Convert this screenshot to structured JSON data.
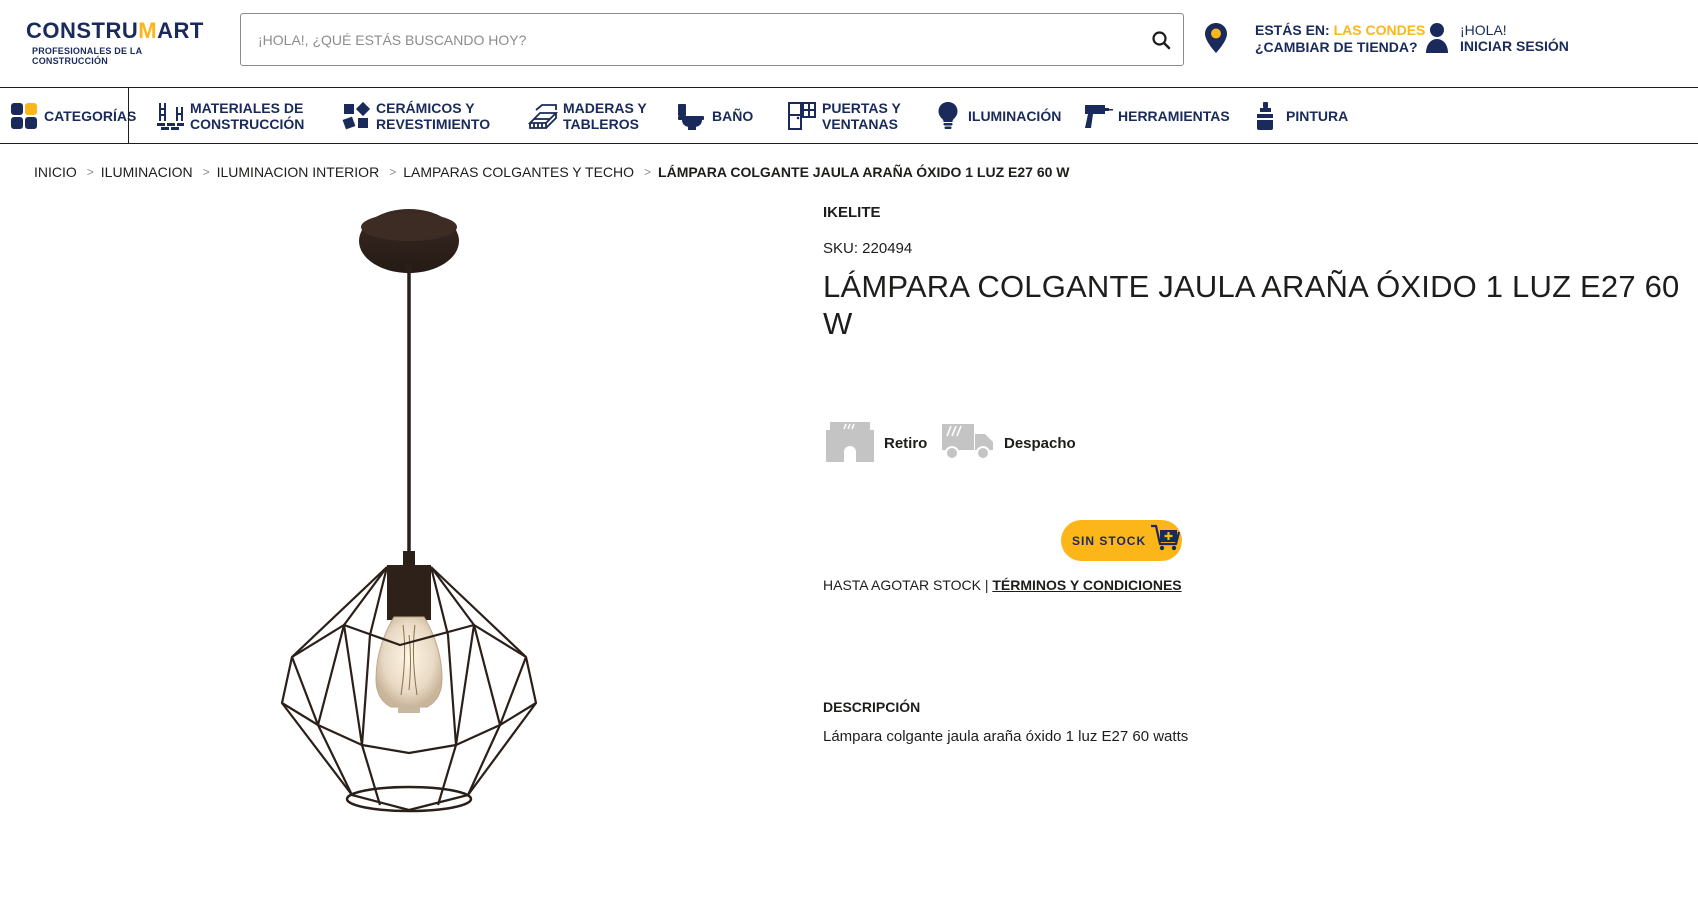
{
  "header": {
    "logo_main_a": "CONSTRU",
    "logo_main_m": "M",
    "logo_main_b": "ART",
    "logo_sub": "PROFESIONALES DE LA CONSTRUCCIÓN",
    "search_placeholder": "¡HOLA!, ¿QUÉ ESTÁS BUSCANDO HOY?",
    "location_prefix": "ESTÁS EN:",
    "location_store": "LAS CONDES",
    "location_change": "¿CAMBIAR DE TIENDA?",
    "user_greeting": "¡HOLA!",
    "user_login": "INICIAR SESIÓN"
  },
  "nav": {
    "items": [
      {
        "label": "CATEGORÍAS"
      },
      {
        "label_1": "MATERIALES DE",
        "label_2": "CONSTRUCCIÓN"
      },
      {
        "label_1": "CERÁMICOS Y",
        "label_2": "REVESTIMIENTO"
      },
      {
        "label_1": "MADERAS Y",
        "label_2": "TABLEROS"
      },
      {
        "label": "BAÑO"
      },
      {
        "label_1": "PUERTAS Y",
        "label_2": "VENTANAS"
      },
      {
        "label": "ILUMINACIÓN"
      },
      {
        "label": "HERRAMIENTAS"
      },
      {
        "label": "PINTURA"
      }
    ]
  },
  "breadcrumb": [
    "INICIO",
    "ILUMINACION",
    "ILUMINACION INTERIOR",
    "LAMPARAS COLGANTES Y TECHO",
    "LÁMPARA COLGANTE JAULA ARAÑA ÓXIDO 1 LUZ E27 60 W"
  ],
  "product": {
    "brand": "IKELITE",
    "sku": "SKU: 220494",
    "title": "LÁMPARA COLGANTE JAULA ARAÑA ÓXIDO 1 LUZ E27 60 W",
    "pickup_label": "Retiro",
    "delivery_label": "Despacho",
    "stock_label": "SIN STOCK",
    "terms_prefix": "HASTA AGOTAR STOCK |",
    "terms_link": "TÉRMINOS Y CONDICIONES",
    "description_heading": "DESCRIPCIÓN",
    "description_text": "Lámpara colgante jaula araña óxido 1 luz E27 60 watts"
  },
  "colors": {
    "brand_navy": "#1a2a5a",
    "accent_yellow": "#fcb61a",
    "text": "#1d1d1b",
    "icon_gray": "#c4c4c4"
  }
}
